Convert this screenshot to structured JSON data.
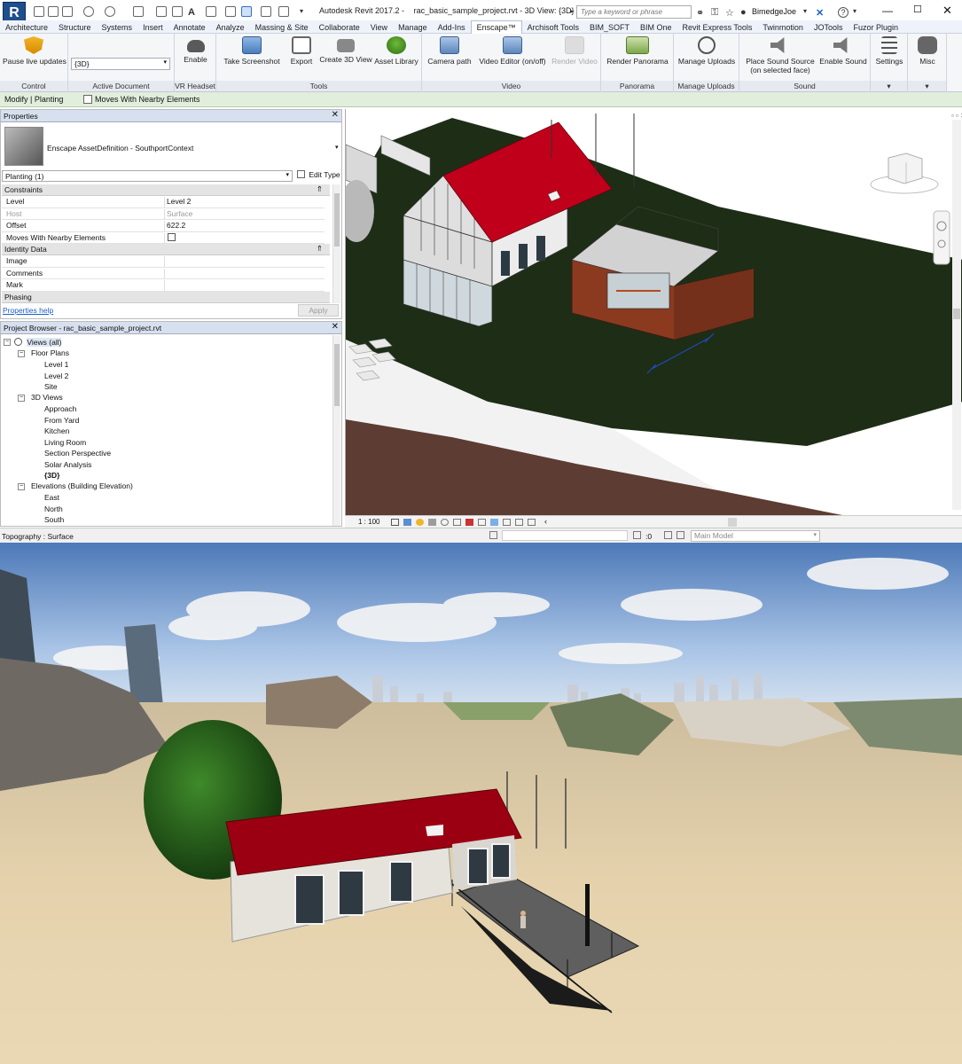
{
  "titlebar": {
    "app_letter": "R",
    "app_name": "Autodesk Revit 2017.2 -",
    "file_title": "rac_basic_sample_project.rvt - 3D View: {3D}",
    "search_placeholder": "Type a keyword or phrase",
    "user": "BimedgeJoe",
    "help": "?"
  },
  "tabs": [
    "Architecture",
    "Structure",
    "Systems",
    "Insert",
    "Annotate",
    "Analyze",
    "Massing & Site",
    "Collaborate",
    "View",
    "Manage",
    "Add-Ins",
    "Enscape™",
    "Archisoft Tools",
    "BIM_SOFT",
    "BIM One",
    "Revit Express Tools",
    "Twinmotion",
    "JOTools",
    "Fuzor Plugin"
  ],
  "active_tab": "Enscape™",
  "ribbon": {
    "pause_live": "Pause live updates",
    "active_doc_value": "{3D}",
    "enable": "Enable",
    "take_screenshot": "Take Screenshot",
    "export": "Export",
    "create_3d_view": "Create 3D View",
    "asset_library": "Asset Library",
    "camera_path": "Camera path",
    "video_editor": "Video Editor (on/off)",
    "render_video": "Render Video",
    "render_panorama": "Render Panorama",
    "manage_uploads": "Manage Uploads",
    "place_sound_source": "Place Sound Source",
    "place_sound_source_sub": "(on selected face)",
    "enable_sound": "Enable Sound",
    "settings": "Settings",
    "misc": "Misc",
    "groups": {
      "control": "Control",
      "active_document": "Active Document",
      "vr_headset": "VR Headset",
      "tools": "Tools",
      "video": "Video",
      "panorama": "Panorama",
      "manage_uploads": "Manage Uploads",
      "sound": "Sound"
    }
  },
  "context": {
    "mode": "Modify | Planting",
    "moves_with_nearby": "Moves With Nearby Elements"
  },
  "properties": {
    "header": "Properties",
    "type_name": "Enscape AssetDefinition - SouthportContext",
    "instance_selector": "Planting (1)",
    "edit_type": "Edit Type",
    "sections": {
      "constraints": "Constraints",
      "identity": "Identity Data",
      "phasing": "Phasing"
    },
    "rows": [
      {
        "k": "Level",
        "v": "Level 2"
      },
      {
        "k": "Host",
        "v": "Surface"
      },
      {
        "k": "Offset",
        "v": "622.2"
      },
      {
        "k": "Moves With Nearby Elements",
        "v": ""
      },
      {
        "k": "Image",
        "v": ""
      },
      {
        "k": "Comments",
        "v": ""
      },
      {
        "k": "Mark",
        "v": ""
      }
    ],
    "help_link": "Properties help",
    "apply": "Apply"
  },
  "browser": {
    "header": "Project Browser - rac_basic_sample_project.rvt",
    "views_all": "Views (all)",
    "floor_plans": "Floor Plans",
    "floor_items": [
      "Level 1",
      "Level 2",
      "Site"
    ],
    "views_3d": "3D Views",
    "views_3d_items": [
      "Approach",
      "From Yard",
      "Kitchen",
      "Living Room",
      "Section Perspective",
      "Solar Analysis",
      "{3D}"
    ],
    "elevations": "Elevations (Building Elevation)",
    "elevation_items": [
      "East",
      "North",
      "South"
    ]
  },
  "view_control": {
    "scale": "1 : 100"
  },
  "status": {
    "text": "Topography : Surface",
    "zero": ":0",
    "model": "Main Model"
  },
  "colors": {
    "roof_red": "#c00018",
    "terrain_green": "#1c2b14",
    "cladding": "#8b3a20",
    "sky": "#6a93c9",
    "ground_sand": "#dcc49a",
    "ribbon_bg": "#f5f6f8",
    "context_green": "#e2eedc"
  }
}
